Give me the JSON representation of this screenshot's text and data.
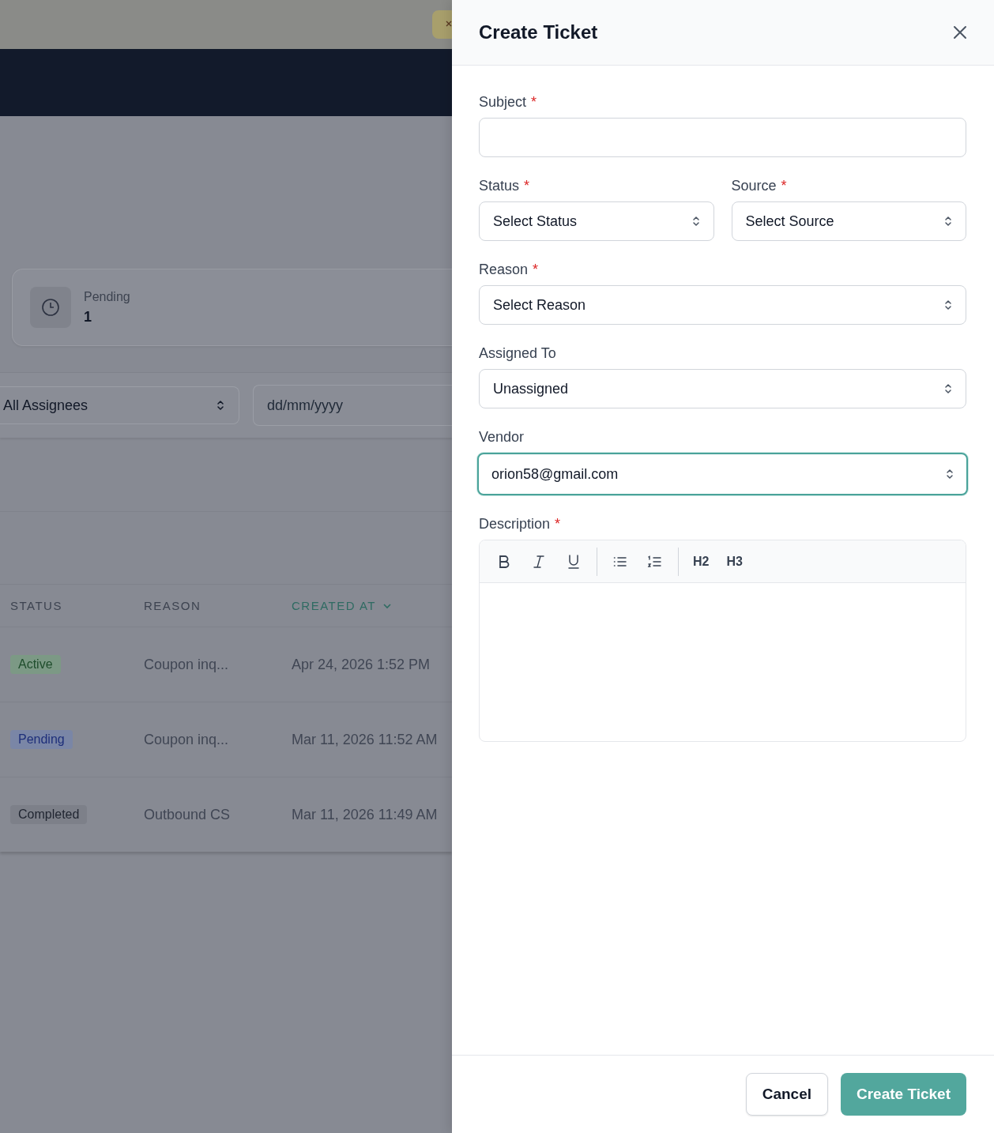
{
  "background": {
    "stat_card": {
      "label": "Pending",
      "value": "1"
    },
    "filters": {
      "assignee": {
        "value": "All Assignees"
      },
      "date": {
        "placeholder": "dd/mm/yyyy"
      }
    },
    "table": {
      "columns": [
        {
          "label": "STATUS",
          "sorted": false
        },
        {
          "label": "REASON",
          "sorted": false
        },
        {
          "label": "CREATED AT",
          "sorted": true
        }
      ],
      "rows": [
        {
          "status": {
            "label": "Active",
            "kind": "active"
          },
          "reason": "Coupon inq...",
          "created_at": "Apr 24, 2026 1:52 PM"
        },
        {
          "status": {
            "label": "Pending",
            "kind": "pending"
          },
          "reason": "Coupon inq...",
          "created_at": "Mar 11, 2026 11:52 AM"
        },
        {
          "status": {
            "label": "Completed",
            "kind": "completed"
          },
          "reason": "Outbound CS",
          "created_at": "Mar 11, 2026 11:49 AM"
        }
      ]
    }
  },
  "drawer": {
    "title": "Create Ticket",
    "rows": [
      [
        {
          "label": "Subject",
          "required_mark": "*",
          "kind": "text",
          "focused": false
        }
      ],
      [
        {
          "label": "Status",
          "required_mark": "*",
          "kind": "select",
          "value": "Select Status",
          "focused": false
        },
        {
          "label": "Source",
          "required_mark": "*",
          "kind": "select",
          "value": "Select Source",
          "focused": false
        }
      ],
      [
        {
          "label": "Reason",
          "required_mark": "*",
          "kind": "select",
          "value": "Select Reason",
          "focused": false
        }
      ],
      [
        {
          "label": "Assigned To",
          "kind": "select",
          "value": "Unassigned",
          "focused": false
        }
      ],
      [
        {
          "label": "Vendor",
          "kind": "select",
          "value": "orion58@gmail.com",
          "focused": true
        }
      ],
      [
        {
          "label": "Description",
          "required_mark": "*",
          "kind": "editor",
          "headings": [
            "H2",
            "H3"
          ]
        }
      ]
    ],
    "buttons": [
      {
        "label": "Cancel",
        "kind": "secondary"
      },
      {
        "label": "Create Ticket",
        "kind": "primary"
      }
    ]
  }
}
